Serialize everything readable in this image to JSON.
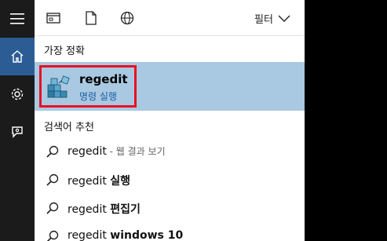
{
  "topbar": {
    "filter_label": "필터"
  },
  "rail": {
    "menu_icon": "hamburger-icon",
    "home_icon": "home-icon",
    "settings_icon": "gear-icon",
    "feedback_icon": "feedback-icon"
  },
  "sections": {
    "best_match": "가장 정확",
    "web_search": "검색어 추천"
  },
  "best_match": {
    "title": "regedit",
    "subtitle": "명령 실행"
  },
  "suggestions": [
    {
      "query": "regedit",
      "suffix": "",
      "hint": " - 웹 결과 보기"
    },
    {
      "query": "regedit ",
      "suffix": "실행",
      "hint": ""
    },
    {
      "query": "regedit ",
      "suffix": "편집기",
      "hint": ""
    },
    {
      "query": "regedit ",
      "suffix": "windows 10",
      "hint": ""
    }
  ],
  "colors": {
    "selected_row": "#a9c8e1",
    "highlight": "#e81123",
    "rail_active": "#2b5d94"
  }
}
